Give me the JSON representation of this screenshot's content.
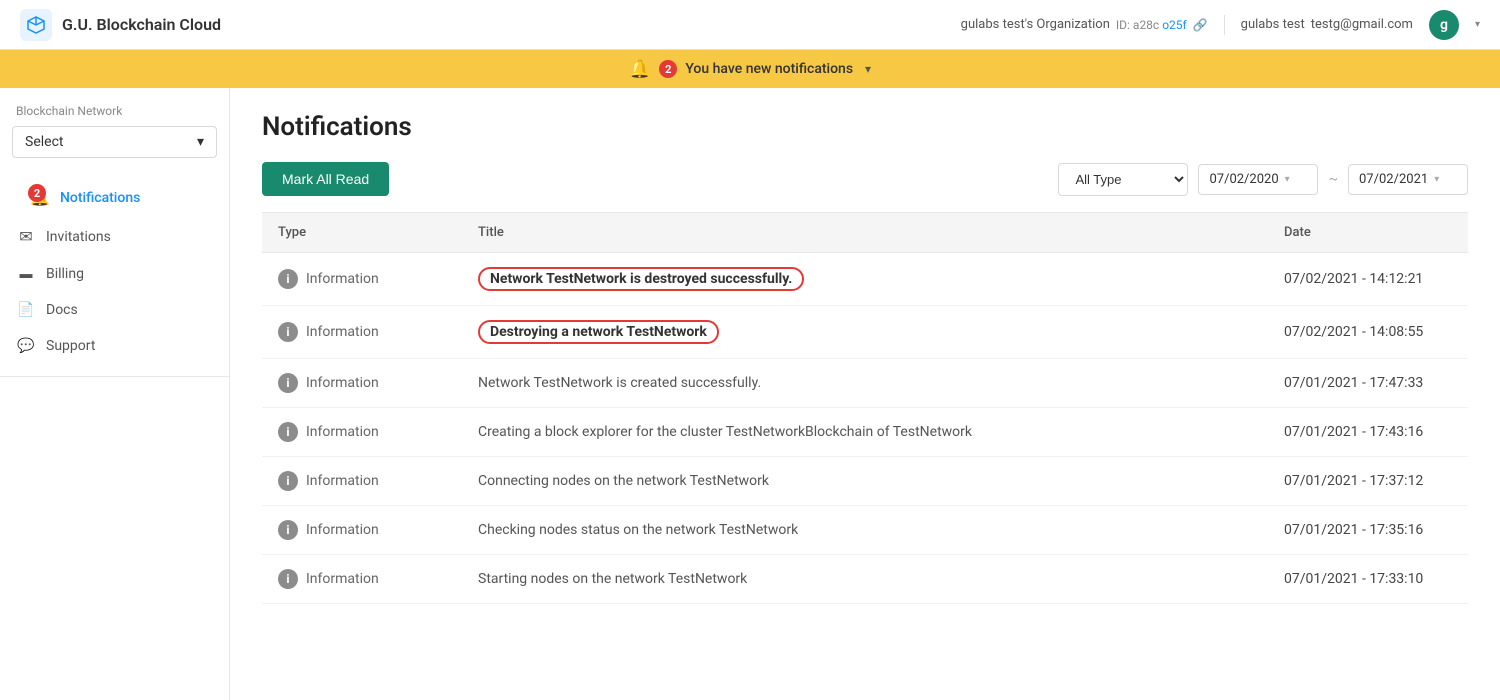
{
  "header": {
    "logo_text": "G.U. Blockchain Cloud",
    "org_name": "gulabs test's Organization",
    "org_id_label": "ID: a28c",
    "org_id_suffix": "o25f",
    "link_icon": "🔗",
    "user_name": "gulabs test",
    "user_email_prefix": "testg",
    "user_email_domain": "@gmail.com",
    "avatar_letter": "g",
    "chevron": "▾"
  },
  "banner": {
    "count": "2",
    "message": "You have new notifications",
    "chevron": "▾"
  },
  "sidebar": {
    "network_label": "Blockchain Network",
    "select_placeholder": "Select",
    "items": [
      {
        "id": "notifications",
        "label": "Notifications",
        "icon": "🔔",
        "badge": "2",
        "active": true
      },
      {
        "id": "invitations",
        "label": "Invitations",
        "icon": "✉",
        "active": false
      },
      {
        "id": "billing",
        "label": "Billing",
        "icon": "▬",
        "active": false
      },
      {
        "id": "docs",
        "label": "Docs",
        "icon": "📄",
        "active": false
      },
      {
        "id": "support",
        "label": "Support",
        "icon": "💬",
        "active": false
      }
    ]
  },
  "main": {
    "page_title": "Notifications",
    "toolbar": {
      "mark_all_read": "Mark All Read",
      "type_filter": "All Type",
      "date_from": "07/02/2020",
      "date_separator": "~",
      "date_to": "07/02/2021"
    },
    "table": {
      "col_type": "Type",
      "col_title": "Title",
      "col_date": "Date",
      "rows": [
        {
          "type": "Information",
          "title": "Network TestNetwork is destroyed successfully.",
          "highlighted": true,
          "date": "07/02/2021 - 14:12:21"
        },
        {
          "type": "Information",
          "title": "Destroying a network TestNetwork",
          "highlighted": true,
          "date": "07/02/2021 - 14:08:55"
        },
        {
          "type": "Information",
          "title": "Network TestNetwork is created successfully.",
          "highlighted": false,
          "date": "07/01/2021 - 17:47:33"
        },
        {
          "type": "Information",
          "title": "Creating a block explorer for the cluster TestNetworkBlockchain of TestNetwork",
          "highlighted": false,
          "date": "07/01/2021 - 17:43:16"
        },
        {
          "type": "Information",
          "title": "Connecting nodes on the network TestNetwork",
          "highlighted": false,
          "date": "07/01/2021 - 17:37:12"
        },
        {
          "type": "Information",
          "title": "Checking nodes status on the network TestNetwork",
          "highlighted": false,
          "date": "07/01/2021 - 17:35:16"
        },
        {
          "type": "Information",
          "title": "Starting nodes on the network TestNetwork",
          "highlighted": false,
          "date": "07/01/2021 - 17:33:10"
        }
      ]
    }
  }
}
